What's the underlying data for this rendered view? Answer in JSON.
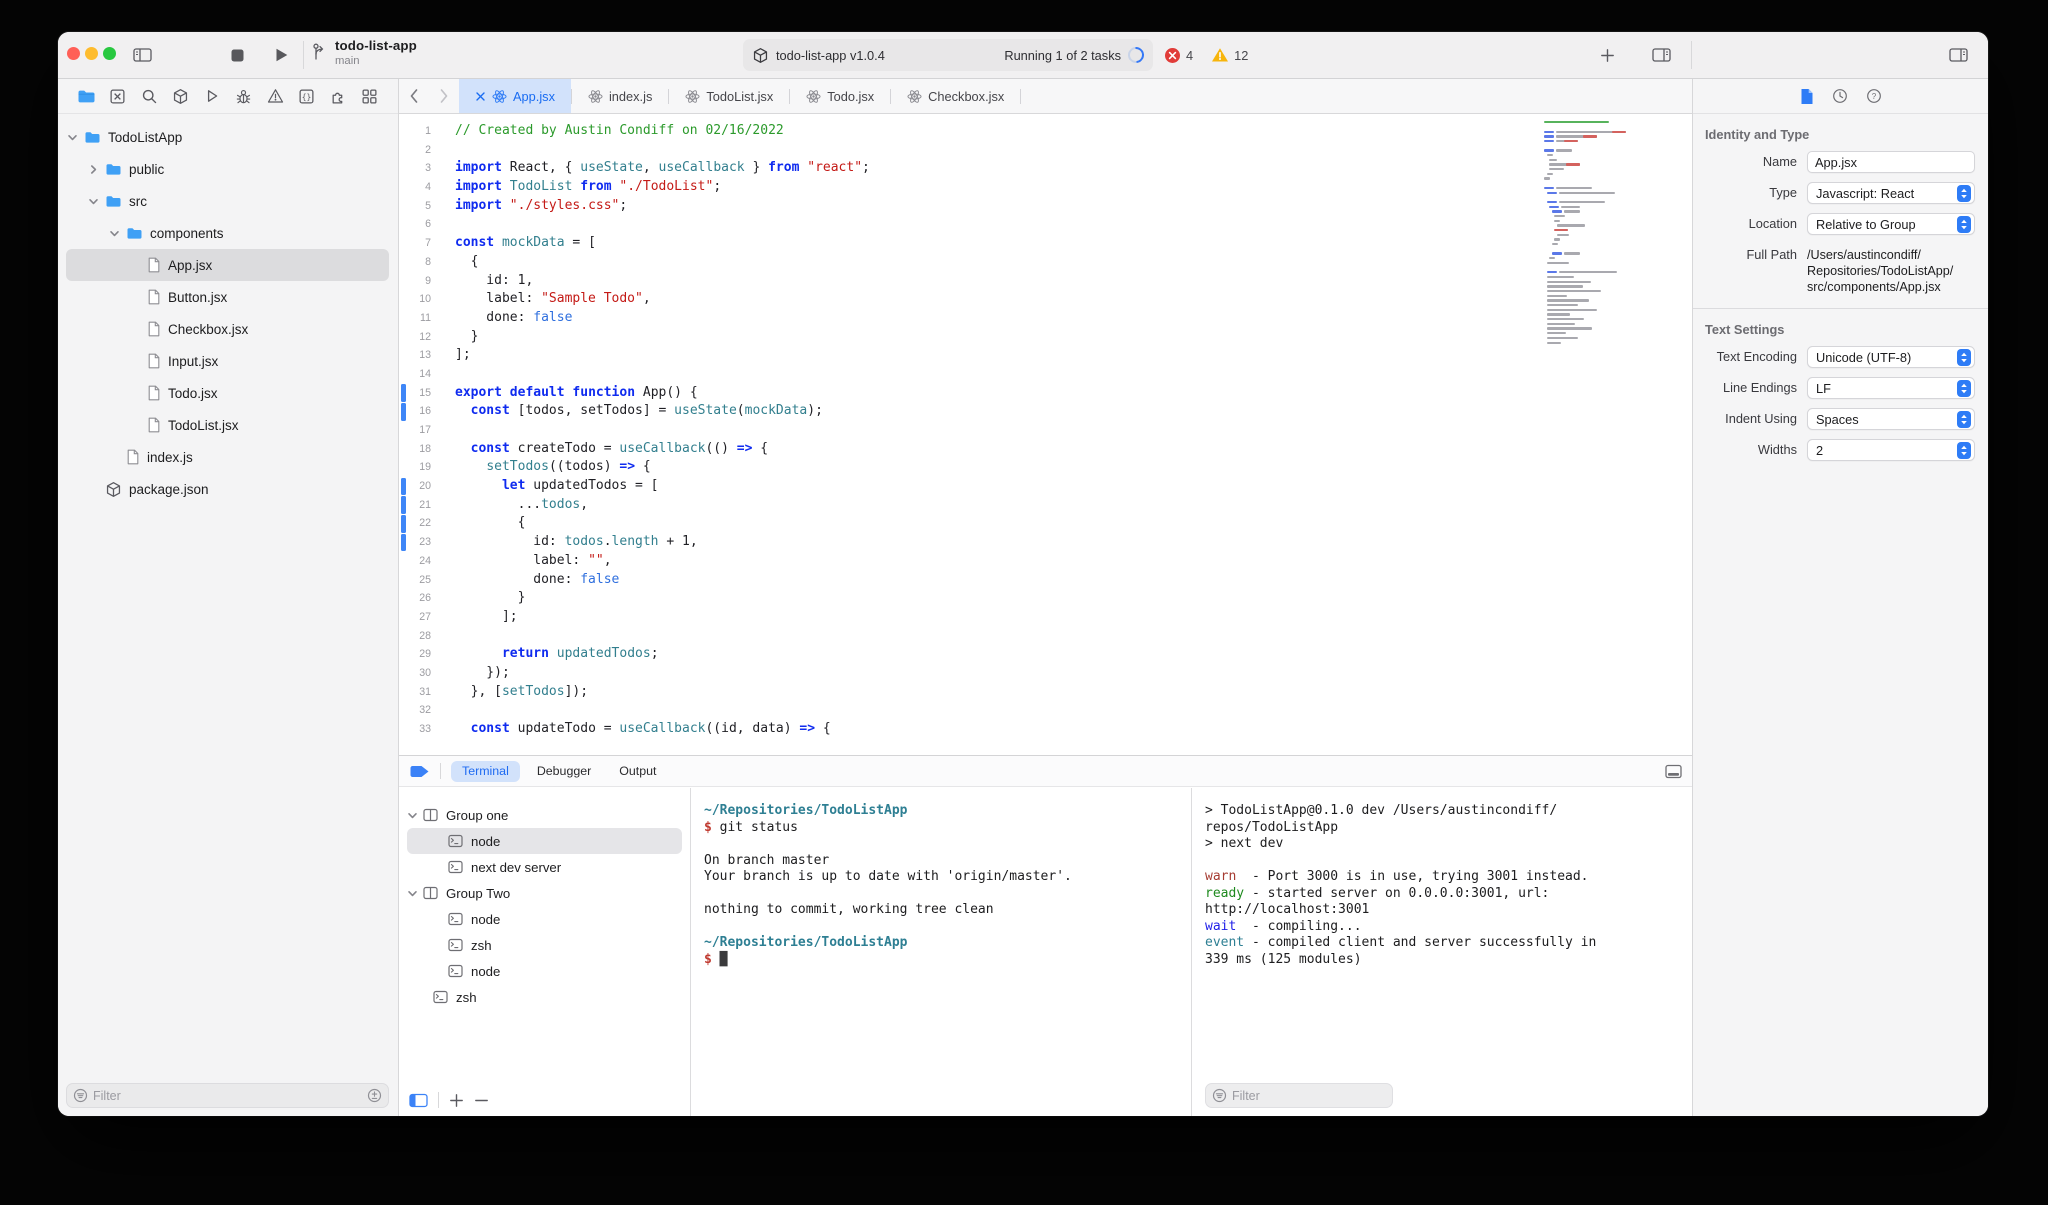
{
  "toolbar": {
    "window_controls": [
      "close",
      "minimize",
      "zoom"
    ],
    "project_name": "todo-list-app",
    "branch_name": "main",
    "activity": {
      "scheme": "todo-list-app v1.0.4",
      "status": "Running 1 of 2 tasks"
    },
    "errors": "4",
    "warnings": "12"
  },
  "navigator_icons": [
    {
      "icon": "folder",
      "active": true
    },
    {
      "icon": "box-x",
      "active": false
    },
    {
      "icon": "search",
      "active": false
    },
    {
      "icon": "cube",
      "active": false
    },
    {
      "icon": "play",
      "active": false
    },
    {
      "icon": "bug",
      "active": false
    },
    {
      "icon": "warning",
      "active": false
    },
    {
      "icon": "braces",
      "active": false
    },
    {
      "icon": "puzzle",
      "active": false
    },
    {
      "icon": "grid",
      "active": false
    }
  ],
  "file_tree": [
    {
      "label": "TodoListApp",
      "type": "folder",
      "level": 0,
      "expanded": true
    },
    {
      "label": "public",
      "type": "folder",
      "level": 1,
      "expanded": false
    },
    {
      "label": "src",
      "type": "folder",
      "level": 1,
      "expanded": true
    },
    {
      "label": "components",
      "type": "folder",
      "level": 2,
      "expanded": true
    },
    {
      "label": "App.jsx",
      "type": "file",
      "level": 3,
      "selected": true
    },
    {
      "label": "Button.jsx",
      "type": "file",
      "level": 3
    },
    {
      "label": "Checkbox.jsx",
      "type": "file",
      "level": 3
    },
    {
      "label": "Input.jsx",
      "type": "file",
      "level": 3
    },
    {
      "label": "Todo.jsx",
      "type": "file",
      "level": 3
    },
    {
      "label": "TodoList.jsx",
      "type": "file",
      "level": 3
    },
    {
      "label": "index.js",
      "type": "file",
      "level": 2
    },
    {
      "label": "package.json",
      "type": "package",
      "level": 1
    }
  ],
  "sidebar_filter": {
    "placeholder": "Filter"
  },
  "editor": {
    "tabs": [
      {
        "label": "App.jsx",
        "active": true
      },
      {
        "label": "index.js",
        "active": false
      },
      {
        "label": "TodoList.jsx",
        "active": false
      },
      {
        "label": "Todo.jsx",
        "active": false
      },
      {
        "label": "Checkbox.jsx",
        "active": false
      }
    ],
    "changed_lines": [
      15,
      16,
      20,
      21,
      22,
      23
    ],
    "lines": [
      {
        "n": 1,
        "tokens": [
          [
            "c",
            "// Created by Austin Condiff on 02/16/2022"
          ]
        ]
      },
      {
        "n": 2,
        "tokens": []
      },
      {
        "n": 3,
        "tokens": [
          [
            "k",
            "import"
          ],
          [
            "p",
            " React, { "
          ],
          [
            "t",
            "useState"
          ],
          [
            "p",
            ", "
          ],
          [
            "t",
            "useCallback"
          ],
          [
            "p",
            " } "
          ],
          [
            "k",
            "from"
          ],
          [
            "p",
            " "
          ],
          [
            "s",
            "\"react\""
          ],
          [
            "p",
            ";"
          ]
        ]
      },
      {
        "n": 4,
        "tokens": [
          [
            "k",
            "import"
          ],
          [
            "p",
            " "
          ],
          [
            "t",
            "TodoList"
          ],
          [
            "p",
            " "
          ],
          [
            "k",
            "from"
          ],
          [
            "p",
            " "
          ],
          [
            "s",
            "\"./TodoList\""
          ],
          [
            "p",
            ";"
          ]
        ]
      },
      {
        "n": 5,
        "tokens": [
          [
            "k",
            "import"
          ],
          [
            "p",
            " "
          ],
          [
            "s",
            "\"./styles.css\""
          ],
          [
            "p",
            ";"
          ]
        ]
      },
      {
        "n": 6,
        "tokens": []
      },
      {
        "n": 7,
        "tokens": [
          [
            "k",
            "const"
          ],
          [
            "p",
            " "
          ],
          [
            "t",
            "mockData"
          ],
          [
            "p",
            " = ["
          ]
        ]
      },
      {
        "n": 8,
        "tokens": [
          [
            "p",
            "  {"
          ]
        ]
      },
      {
        "n": 9,
        "tokens": [
          [
            "p",
            "    id: 1,"
          ]
        ]
      },
      {
        "n": 10,
        "tokens": [
          [
            "p",
            "    label: "
          ],
          [
            "s",
            "\"Sample Todo\""
          ],
          [
            "p",
            ","
          ]
        ]
      },
      {
        "n": 11,
        "tokens": [
          [
            "p",
            "    done: "
          ],
          [
            "b",
            "false"
          ]
        ]
      },
      {
        "n": 12,
        "tokens": [
          [
            "p",
            "  }"
          ]
        ]
      },
      {
        "n": 13,
        "tokens": [
          [
            "p",
            "];"
          ]
        ]
      },
      {
        "n": 14,
        "tokens": []
      },
      {
        "n": 15,
        "tokens": [
          [
            "k",
            "export"
          ],
          [
            "p",
            " "
          ],
          [
            "k",
            "default"
          ],
          [
            "p",
            " "
          ],
          [
            "k",
            "function"
          ],
          [
            "p",
            " App() {"
          ]
        ]
      },
      {
        "n": 16,
        "tokens": [
          [
            "p",
            "  "
          ],
          [
            "k",
            "const"
          ],
          [
            "p",
            " [todos, setTodos] = "
          ],
          [
            "t",
            "useState"
          ],
          [
            "p",
            "("
          ],
          [
            "t",
            "mockData"
          ],
          [
            "p",
            ");"
          ]
        ]
      },
      {
        "n": 17,
        "tokens": []
      },
      {
        "n": 18,
        "tokens": [
          [
            "p",
            "  "
          ],
          [
            "k",
            "const"
          ],
          [
            "p",
            " createTodo = "
          ],
          [
            "t",
            "useCallback"
          ],
          [
            "p",
            "(() "
          ],
          [
            "k",
            "=>"
          ],
          [
            "p",
            " {"
          ]
        ]
      },
      {
        "n": 19,
        "tokens": [
          [
            "p",
            "    "
          ],
          [
            "t",
            "setTodos"
          ],
          [
            "p",
            "((todos) "
          ],
          [
            "k",
            "=>"
          ],
          [
            "p",
            " {"
          ]
        ]
      },
      {
        "n": 20,
        "tokens": [
          [
            "p",
            "      "
          ],
          [
            "k",
            "let"
          ],
          [
            "p",
            " updatedTodos = ["
          ]
        ]
      },
      {
        "n": 21,
        "tokens": [
          [
            "p",
            "        ..."
          ],
          [
            "t",
            "todos"
          ],
          [
            "p",
            ","
          ]
        ]
      },
      {
        "n": 22,
        "tokens": [
          [
            "p",
            "        {"
          ]
        ]
      },
      {
        "n": 23,
        "tokens": [
          [
            "p",
            "          id: "
          ],
          [
            "t",
            "todos"
          ],
          [
            "p",
            "."
          ],
          [
            "t",
            "length"
          ],
          [
            "p",
            " + 1,"
          ]
        ]
      },
      {
        "n": 24,
        "tokens": [
          [
            "p",
            "          label: "
          ],
          [
            "s",
            "\"\""
          ],
          [
            "p",
            ","
          ]
        ]
      },
      {
        "n": 25,
        "tokens": [
          [
            "p",
            "          done: "
          ],
          [
            "b",
            "false"
          ]
        ]
      },
      {
        "n": 26,
        "tokens": [
          [
            "p",
            "        }"
          ]
        ]
      },
      {
        "n": 27,
        "tokens": [
          [
            "p",
            "      ];"
          ]
        ]
      },
      {
        "n": 28,
        "tokens": []
      },
      {
        "n": 29,
        "tokens": [
          [
            "p",
            "      "
          ],
          [
            "k",
            "return"
          ],
          [
            "p",
            " "
          ],
          [
            "t",
            "updatedTodos"
          ],
          [
            "p",
            ";"
          ]
        ]
      },
      {
        "n": 30,
        "tokens": [
          [
            "p",
            "    });"
          ]
        ]
      },
      {
        "n": 31,
        "tokens": [
          [
            "p",
            "  }, ["
          ],
          [
            "t",
            "setTodos"
          ],
          [
            "p",
            "]);"
          ]
        ]
      },
      {
        "n": 32,
        "tokens": []
      },
      {
        "n": 33,
        "tokens": [
          [
            "p",
            "  "
          ],
          [
            "k",
            "const"
          ],
          [
            "p",
            " updateTodo = "
          ],
          [
            "t",
            "useCallback"
          ],
          [
            "p",
            "((id, data) "
          ],
          [
            "k",
            "=>"
          ],
          [
            "p",
            " {"
          ]
        ]
      }
    ]
  },
  "inspector": {
    "sections": [
      {
        "title": "Identity and Type",
        "rows": [
          {
            "label": "Name",
            "value": "App.jsx",
            "control": "input"
          },
          {
            "label": "Type",
            "value": "Javascript: React",
            "control": "select"
          },
          {
            "label": "Location",
            "value": "Relative to Group",
            "control": "select"
          },
          {
            "label": "Full Path",
            "value": "/Users/austincondiff/\nRepositories/TodoListApp/\nsrc/components/App.jsx",
            "control": "text"
          }
        ]
      },
      {
        "title": "Text Settings",
        "rows": [
          {
            "label": "Text Encoding",
            "value": "Unicode (UTF-8)",
            "control": "select"
          },
          {
            "label": "Line Endings",
            "value": "LF",
            "control": "select"
          },
          {
            "label": "Indent Using",
            "value": "Spaces",
            "control": "select"
          },
          {
            "label": "Widths",
            "value": "2",
            "control": "select"
          }
        ]
      }
    ]
  },
  "bottom_panel": {
    "tabs": [
      {
        "label": "Terminal",
        "active": true
      },
      {
        "label": "Debugger",
        "active": false
      },
      {
        "label": "Output",
        "active": false
      }
    ],
    "sessions": [
      {
        "label": "Group one",
        "type": "group",
        "level": 0,
        "expanded": true
      },
      {
        "label": "node",
        "type": "term",
        "level": 1,
        "selected": true
      },
      {
        "label": "next dev server",
        "type": "term",
        "level": 1
      },
      {
        "label": "Group Two",
        "type": "group",
        "level": 0,
        "expanded": true
      },
      {
        "label": "node",
        "type": "term",
        "level": 1
      },
      {
        "label": "zsh",
        "type": "term",
        "level": 1
      },
      {
        "label": "node",
        "type": "term",
        "level": 1
      },
      {
        "label": "zsh",
        "type": "term",
        "level": 0
      }
    ],
    "terminal_git": {
      "lines": [
        [
          [
            "path",
            "~/Repositories/TodoListApp"
          ]
        ],
        [
          [
            "prompt",
            "$"
          ],
          [
            "plain",
            " git status"
          ]
        ],
        [],
        [
          [
            "plain",
            "On branch master"
          ]
        ],
        [
          [
            "plain",
            "Your branch is up to date with 'origin/master'."
          ]
        ],
        [],
        [
          [
            "plain",
            "nothing to commit, working tree clean"
          ]
        ],
        [],
        [
          [
            "path",
            "~/Repositories/TodoListApp"
          ]
        ],
        [
          [
            "prompt",
            "$"
          ],
          [
            "plain",
            " "
          ],
          [
            "cursor",
            "█"
          ]
        ]
      ]
    },
    "terminal_dev": {
      "lines": [
        [
          [
            "plain",
            "> TodoListApp@0.1.0 dev /Users/austincondiff/"
          ]
        ],
        [
          [
            "plain",
            "repos/TodoListApp"
          ]
        ],
        [
          [
            "plain",
            "> next dev"
          ]
        ],
        [],
        [
          [
            "warn",
            "warn"
          ],
          [
            "plain",
            "  - Port 3000 is in use, trying 3001 instead."
          ]
        ],
        [
          [
            "ready",
            "ready"
          ],
          [
            "plain",
            " - started server on 0.0.0.0:3001, url:"
          ]
        ],
        [
          [
            "plain",
            "http://localhost:3001"
          ]
        ],
        [
          [
            "wait",
            "wait"
          ],
          [
            "plain",
            "  - compiling..."
          ]
        ],
        [
          [
            "event",
            "event"
          ],
          [
            "plain",
            " - compiled client and server successfully in"
          ]
        ],
        [
          [
            "plain",
            "339 ms (125 modules)"
          ]
        ]
      ]
    },
    "filter_placeholder": "Filter"
  }
}
